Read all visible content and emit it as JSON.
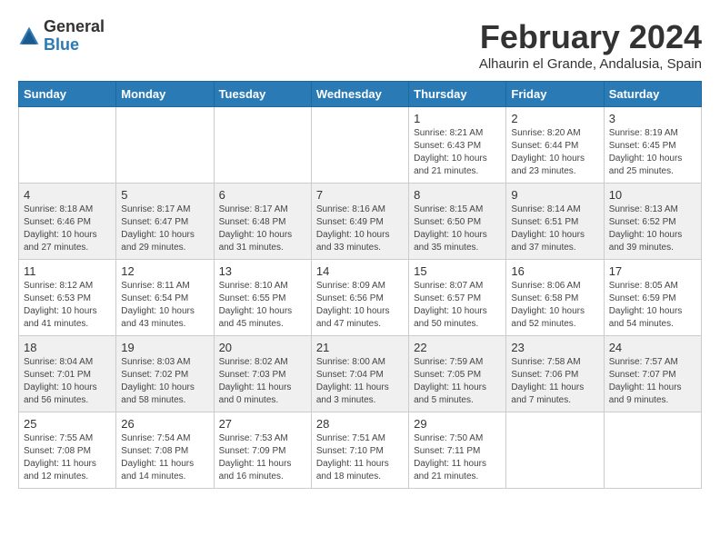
{
  "header": {
    "logo_general": "General",
    "logo_blue": "Blue",
    "month_title": "February 2024",
    "subtitle": "Alhaurin el Grande, Andalusia, Spain"
  },
  "weekdays": [
    "Sunday",
    "Monday",
    "Tuesday",
    "Wednesday",
    "Thursday",
    "Friday",
    "Saturday"
  ],
  "weeks": [
    [
      {
        "day": "",
        "info": ""
      },
      {
        "day": "",
        "info": ""
      },
      {
        "day": "",
        "info": ""
      },
      {
        "day": "",
        "info": ""
      },
      {
        "day": "1",
        "info": "Sunrise: 8:21 AM\nSunset: 6:43 PM\nDaylight: 10 hours\nand 21 minutes."
      },
      {
        "day": "2",
        "info": "Sunrise: 8:20 AM\nSunset: 6:44 PM\nDaylight: 10 hours\nand 23 minutes."
      },
      {
        "day": "3",
        "info": "Sunrise: 8:19 AM\nSunset: 6:45 PM\nDaylight: 10 hours\nand 25 minutes."
      }
    ],
    [
      {
        "day": "4",
        "info": "Sunrise: 8:18 AM\nSunset: 6:46 PM\nDaylight: 10 hours\nand 27 minutes."
      },
      {
        "day": "5",
        "info": "Sunrise: 8:17 AM\nSunset: 6:47 PM\nDaylight: 10 hours\nand 29 minutes."
      },
      {
        "day": "6",
        "info": "Sunrise: 8:17 AM\nSunset: 6:48 PM\nDaylight: 10 hours\nand 31 minutes."
      },
      {
        "day": "7",
        "info": "Sunrise: 8:16 AM\nSunset: 6:49 PM\nDaylight: 10 hours\nand 33 minutes."
      },
      {
        "day": "8",
        "info": "Sunrise: 8:15 AM\nSunset: 6:50 PM\nDaylight: 10 hours\nand 35 minutes."
      },
      {
        "day": "9",
        "info": "Sunrise: 8:14 AM\nSunset: 6:51 PM\nDaylight: 10 hours\nand 37 minutes."
      },
      {
        "day": "10",
        "info": "Sunrise: 8:13 AM\nSunset: 6:52 PM\nDaylight: 10 hours\nand 39 minutes."
      }
    ],
    [
      {
        "day": "11",
        "info": "Sunrise: 8:12 AM\nSunset: 6:53 PM\nDaylight: 10 hours\nand 41 minutes."
      },
      {
        "day": "12",
        "info": "Sunrise: 8:11 AM\nSunset: 6:54 PM\nDaylight: 10 hours\nand 43 minutes."
      },
      {
        "day": "13",
        "info": "Sunrise: 8:10 AM\nSunset: 6:55 PM\nDaylight: 10 hours\nand 45 minutes."
      },
      {
        "day": "14",
        "info": "Sunrise: 8:09 AM\nSunset: 6:56 PM\nDaylight: 10 hours\nand 47 minutes."
      },
      {
        "day": "15",
        "info": "Sunrise: 8:07 AM\nSunset: 6:57 PM\nDaylight: 10 hours\nand 50 minutes."
      },
      {
        "day": "16",
        "info": "Sunrise: 8:06 AM\nSunset: 6:58 PM\nDaylight: 10 hours\nand 52 minutes."
      },
      {
        "day": "17",
        "info": "Sunrise: 8:05 AM\nSunset: 6:59 PM\nDaylight: 10 hours\nand 54 minutes."
      }
    ],
    [
      {
        "day": "18",
        "info": "Sunrise: 8:04 AM\nSunset: 7:01 PM\nDaylight: 10 hours\nand 56 minutes."
      },
      {
        "day": "19",
        "info": "Sunrise: 8:03 AM\nSunset: 7:02 PM\nDaylight: 10 hours\nand 58 minutes."
      },
      {
        "day": "20",
        "info": "Sunrise: 8:02 AM\nSunset: 7:03 PM\nDaylight: 11 hours\nand 0 minutes."
      },
      {
        "day": "21",
        "info": "Sunrise: 8:00 AM\nSunset: 7:04 PM\nDaylight: 11 hours\nand 3 minutes."
      },
      {
        "day": "22",
        "info": "Sunrise: 7:59 AM\nSunset: 7:05 PM\nDaylight: 11 hours\nand 5 minutes."
      },
      {
        "day": "23",
        "info": "Sunrise: 7:58 AM\nSunset: 7:06 PM\nDaylight: 11 hours\nand 7 minutes."
      },
      {
        "day": "24",
        "info": "Sunrise: 7:57 AM\nSunset: 7:07 PM\nDaylight: 11 hours\nand 9 minutes."
      }
    ],
    [
      {
        "day": "25",
        "info": "Sunrise: 7:55 AM\nSunset: 7:08 PM\nDaylight: 11 hours\nand 12 minutes."
      },
      {
        "day": "26",
        "info": "Sunrise: 7:54 AM\nSunset: 7:08 PM\nDaylight: 11 hours\nand 14 minutes."
      },
      {
        "day": "27",
        "info": "Sunrise: 7:53 AM\nSunset: 7:09 PM\nDaylight: 11 hours\nand 16 minutes."
      },
      {
        "day": "28",
        "info": "Sunrise: 7:51 AM\nSunset: 7:10 PM\nDaylight: 11 hours\nand 18 minutes."
      },
      {
        "day": "29",
        "info": "Sunrise: 7:50 AM\nSunset: 7:11 PM\nDaylight: 11 hours\nand 21 minutes."
      },
      {
        "day": "",
        "info": ""
      },
      {
        "day": "",
        "info": ""
      }
    ]
  ]
}
